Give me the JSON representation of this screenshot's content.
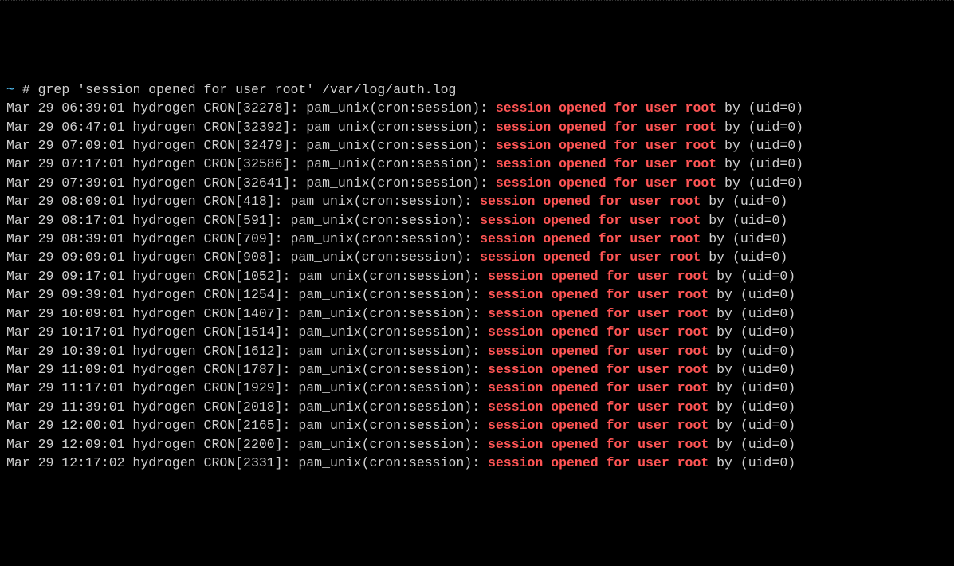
{
  "prompt": {
    "tilde": "~",
    "hash": "#",
    "command": "grep 'session opened for user root' /var/log/auth.log"
  },
  "match_text": "session opened for user root",
  "lines": [
    {
      "ts": "Mar 29 06:39:01",
      "host": "hydrogen",
      "proc": "CRON",
      "pid": "32278",
      "suffix": "by (uid=0)"
    },
    {
      "ts": "Mar 29 06:47:01",
      "host": "hydrogen",
      "proc": "CRON",
      "pid": "32392",
      "suffix": "by (uid=0)"
    },
    {
      "ts": "Mar 29 07:09:01",
      "host": "hydrogen",
      "proc": "CRON",
      "pid": "32479",
      "suffix": "by (uid=0)"
    },
    {
      "ts": "Mar 29 07:17:01",
      "host": "hydrogen",
      "proc": "CRON",
      "pid": "32586",
      "suffix": "by (uid=0)"
    },
    {
      "ts": "Mar 29 07:39:01",
      "host": "hydrogen",
      "proc": "CRON",
      "pid": "32641",
      "suffix": "by (uid=0)"
    },
    {
      "ts": "Mar 29 08:09:01",
      "host": "hydrogen",
      "proc": "CRON",
      "pid": "418",
      "suffix": "by (uid=0)"
    },
    {
      "ts": "Mar 29 08:17:01",
      "host": "hydrogen",
      "proc": "CRON",
      "pid": "591",
      "suffix": "by (uid=0)"
    },
    {
      "ts": "Mar 29 08:39:01",
      "host": "hydrogen",
      "proc": "CRON",
      "pid": "709",
      "suffix": "by (uid=0)"
    },
    {
      "ts": "Mar 29 09:09:01",
      "host": "hydrogen",
      "proc": "CRON",
      "pid": "908",
      "suffix": "by (uid=0)"
    },
    {
      "ts": "Mar 29 09:17:01",
      "host": "hydrogen",
      "proc": "CRON",
      "pid": "1052",
      "suffix": "by (uid=0)"
    },
    {
      "ts": "Mar 29 09:39:01",
      "host": "hydrogen",
      "proc": "CRON",
      "pid": "1254",
      "suffix": "by (uid=0)"
    },
    {
      "ts": "Mar 29 10:09:01",
      "host": "hydrogen",
      "proc": "CRON",
      "pid": "1407",
      "suffix": "by (uid=0)"
    },
    {
      "ts": "Mar 29 10:17:01",
      "host": "hydrogen",
      "proc": "CRON",
      "pid": "1514",
      "suffix": "by (uid=0)"
    },
    {
      "ts": "Mar 29 10:39:01",
      "host": "hydrogen",
      "proc": "CRON",
      "pid": "1612",
      "suffix": "by (uid=0)"
    },
    {
      "ts": "Mar 29 11:09:01",
      "host": "hydrogen",
      "proc": "CRON",
      "pid": "1787",
      "suffix": "by (uid=0)"
    },
    {
      "ts": "Mar 29 11:17:01",
      "host": "hydrogen",
      "proc": "CRON",
      "pid": "1929",
      "suffix": "by (uid=0)"
    },
    {
      "ts": "Mar 29 11:39:01",
      "host": "hydrogen",
      "proc": "CRON",
      "pid": "2018",
      "suffix": "by (uid=0)"
    },
    {
      "ts": "Mar 29 12:00:01",
      "host": "hydrogen",
      "proc": "CRON",
      "pid": "2165",
      "suffix": "by (uid=0)"
    },
    {
      "ts": "Mar 29 12:09:01",
      "host": "hydrogen",
      "proc": "CRON",
      "pid": "2200",
      "suffix": "by (uid=0)"
    },
    {
      "ts": "Mar 29 12:17:02",
      "host": "hydrogen",
      "proc": "CRON",
      "pid": "2331",
      "suffix": "by (uid=0)"
    }
  ],
  "pam_text": "pam_unix(cron:session):"
}
